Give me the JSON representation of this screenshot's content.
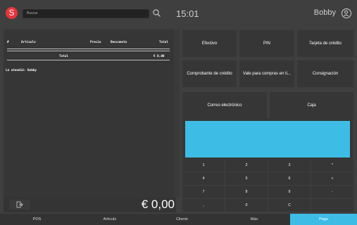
{
  "app": {
    "logo_letter": "S"
  },
  "search": {
    "placeholder": "Buscar"
  },
  "header": {
    "time": "15:01",
    "user": "Bobby"
  },
  "receipt": {
    "columns": [
      "#",
      "Artículo",
      "Precio",
      "Descuento",
      "Total"
    ],
    "total_label": "Total",
    "total_value": "€ 0,00",
    "served_by": "Le atendió: Bobby"
  },
  "total_display": "€ 0,00",
  "payment_buttons": [
    "Efectivo",
    "PIN",
    "Tarjeta de crédito",
    "Comprobante de crédito",
    "Vale para compras en ti...",
    "Consignación",
    "Correo electrónico",
    "Caja"
  ],
  "keypad": [
    [
      "1",
      "2",
      "3",
      "*"
    ],
    [
      "4",
      "5",
      "6",
      "+"
    ],
    [
      "7",
      "8",
      "9",
      "-"
    ],
    [
      ",",
      "0",
      "C",
      ""
    ]
  ],
  "nav_tabs": [
    "POS",
    "Artículo",
    "Cliente",
    "Más",
    "Pago"
  ],
  "colors": {
    "accent": "#3dbde6",
    "brand": "#e8333a",
    "background": "#3f3f3f",
    "panel": "#363636"
  }
}
